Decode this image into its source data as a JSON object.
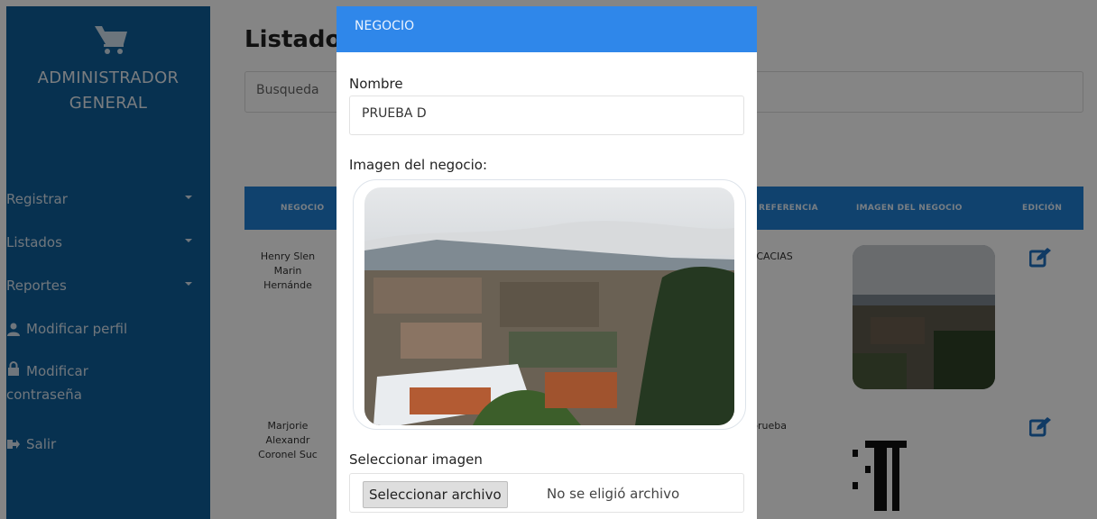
{
  "sidebar": {
    "brand_line1": "ADMINISTRADOR",
    "brand_line2": "GENERAL",
    "items": [
      {
        "label": "Registrar",
        "icon": "chevron-down-icon"
      },
      {
        "label": "Listados",
        "icon": "chevron-down-icon"
      },
      {
        "label": "Reportes",
        "icon": "chevron-down-icon"
      },
      {
        "label": "Modificar perfil",
        "icon": "user-icon"
      },
      {
        "label_line1": "Modificar",
        "label_line2": "contraseña",
        "icon": "lock-icon"
      },
      {
        "label": "Salir",
        "icon": "sign-out-icon"
      }
    ]
  },
  "main": {
    "title": "Listado",
    "search_placeholder": "Busqueda",
    "columns": [
      "NEGOCIO",
      "REFERENCIA",
      "IMAGEN DEL NEGOCIO",
      "EDICIÓN"
    ],
    "rows": [
      {
        "name_lines": [
          "Henry Slen",
          "Marin",
          "Hernánde"
        ],
        "reference": "ACACIAS"
      },
      {
        "name_lines": [
          "Marjorie",
          "Alexandr",
          "Coronel Suc"
        ],
        "reference": "prueba"
      }
    ]
  },
  "modal": {
    "title": "NEGOCIO",
    "name_label": "Nombre",
    "name_value": "PRUEBA D",
    "image_label": "Imagen del negocio:",
    "select_label": "Seleccionar imagen",
    "file_button": "Seleccionar archivo",
    "file_status": "No se eligió archivo"
  },
  "colors": {
    "sidebar": "#0e5f99",
    "table_header": "#1f7fd4",
    "modal_header": "#2f87ea"
  }
}
